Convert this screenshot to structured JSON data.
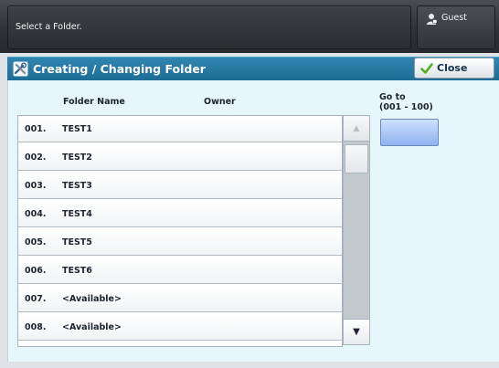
{
  "message": "Select a Folder.",
  "user": {
    "label": "Guest",
    "icon": "user-lock-icon"
  },
  "title": {
    "text": "Creating / Changing Folder",
    "icon": "tools-icon"
  },
  "close_button": {
    "label": "Close",
    "icon": "checkmark-icon"
  },
  "columns": {
    "folder_name": "Folder Name",
    "owner": "Owner"
  },
  "rows": [
    {
      "num": "001.",
      "name": "TEST1"
    },
    {
      "num": "002.",
      "name": "TEST2"
    },
    {
      "num": "003.",
      "name": "TEST3"
    },
    {
      "num": "004.",
      "name": "TEST4"
    },
    {
      "num": "005.",
      "name": "TEST5"
    },
    {
      "num": "006.",
      "name": "TEST6"
    },
    {
      "num": "007.",
      "name": "<Available>"
    },
    {
      "num": "008.",
      "name": "<Available>"
    }
  ],
  "goto": {
    "label": "Go to",
    "range": "(001 - 100)",
    "value": ""
  },
  "scroll": {
    "up": "▲",
    "down": "▼"
  },
  "colors": {
    "title_bar": "#1f6d97",
    "panel": "#e7f6fb",
    "goto_field": "#a9c4f6"
  }
}
